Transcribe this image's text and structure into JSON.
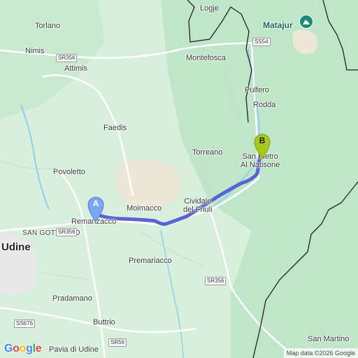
{
  "map": {
    "colors": {
      "land": "#d7efdb",
      "forest": "#bfe6c8",
      "clearing": "#ece7d9",
      "river": "#8fd0ee",
      "road": "#ffffff",
      "border": "#222222",
      "route": "#5a62d6",
      "marker_a": "#7ba6f2",
      "marker_b": "#a7c91c"
    },
    "places": [
      {
        "key": "logje",
        "name": "Logje"
      },
      {
        "key": "matajur",
        "name": "Matajur"
      },
      {
        "key": "torlano",
        "name": "Torlano"
      },
      {
        "key": "nimis",
        "name": "Nimis"
      },
      {
        "key": "attimis",
        "name": "Attimis"
      },
      {
        "key": "montefosca",
        "name": "Montefosca"
      },
      {
        "key": "pulfero",
        "name": "Pulfero"
      },
      {
        "key": "rodda",
        "name": "Rodda"
      },
      {
        "key": "faedis",
        "name": "Faedis"
      },
      {
        "key": "torreano",
        "name": "Torreano"
      },
      {
        "key": "san_pietro",
        "name": "San Pietro\nAl Natisone"
      },
      {
        "key": "povoletto",
        "name": "Povoletto"
      },
      {
        "key": "moimacco",
        "name": "Moimacco"
      },
      {
        "key": "cividale",
        "name": "Cividale\ndel Friuli"
      },
      {
        "key": "remanzacco",
        "name": "Remanzacco"
      },
      {
        "key": "san_gottardo",
        "name": "SAN GOTTARDO"
      },
      {
        "key": "udine",
        "name": "Udine"
      },
      {
        "key": "premariacco",
        "name": "Premariacco"
      },
      {
        "key": "pradamano",
        "name": "Pradamano"
      },
      {
        "key": "buttrio",
        "name": "Buttrio"
      },
      {
        "key": "pavia_di_udine",
        "name": "Pavia di Udine"
      },
      {
        "key": "san_martino",
        "name": "San Martino"
      }
    ],
    "road_shields": {
      "sr356_north": "SR356",
      "ss54": "SS54",
      "sr356_west": "SR356",
      "sr356_south": "SR356",
      "ss676": "SS676",
      "sr56": "SR56"
    },
    "markers": {
      "start": {
        "letter": "A",
        "place": "Remanzacco"
      },
      "end": {
        "letter": "B",
        "place": "San Pietro Al Natisone"
      }
    },
    "logo": "Google",
    "attribution": "Map data ©2026 Google"
  }
}
